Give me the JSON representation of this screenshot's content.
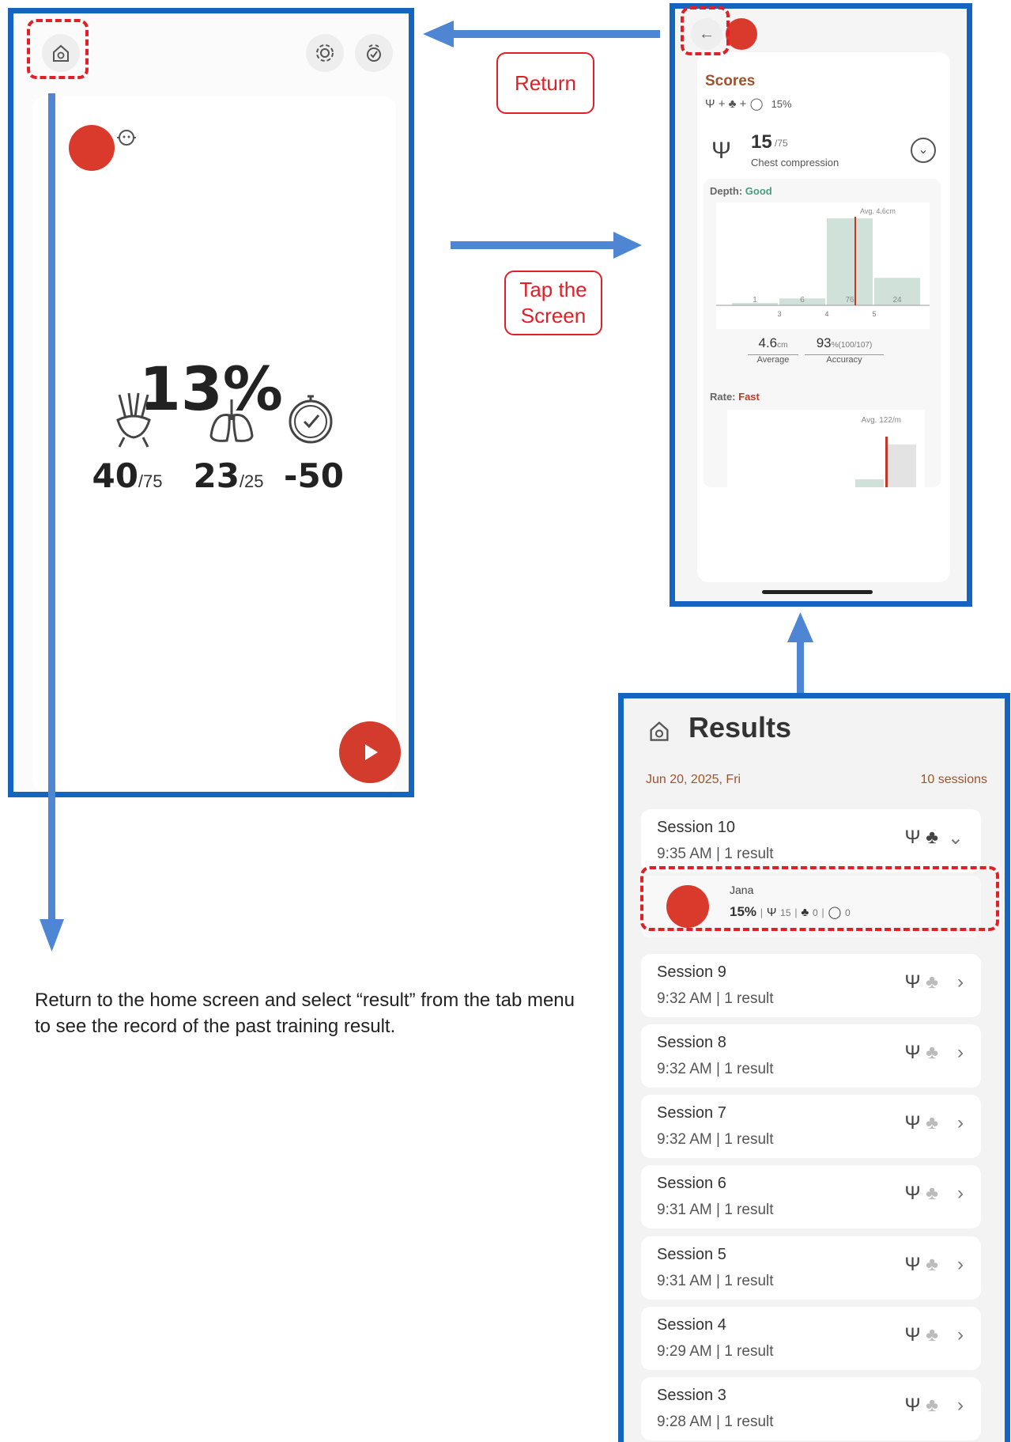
{
  "colors": {
    "frame": "#1565c0",
    "arrow": "#4f86d4",
    "accent_red": "#d93a2b",
    "callout_red": "#e01f26",
    "bar_green": "#cfe1d9"
  },
  "left_screen": {
    "score": "13%",
    "metrics": [
      {
        "icon": "compression-hands-icon",
        "value": "40",
        "max": "/75"
      },
      {
        "icon": "lungs-icon",
        "value": "23",
        "max": "/25"
      },
      {
        "icon": "stopwatch-icon",
        "value": "-50",
        "max": ""
      }
    ],
    "top_icons": [
      "home-icon",
      "settings-icon",
      "stethoscope-icon"
    ],
    "play_icon": "play-icon"
  },
  "callouts": {
    "return": "Return",
    "tap_line1": "Tap the",
    "tap_line2": "Screen"
  },
  "instruction": "Return to the home screen and select “result” from the tab menu to see the record of the past training result.",
  "score_screen": {
    "back_icon": "←",
    "title": "Scores",
    "formula_pct": "15%",
    "compression_score": "15",
    "compression_max": "/75",
    "compression_label": "Chest compression",
    "depth_label": "Depth:",
    "depth_value": "Good",
    "rate_label": "Rate:",
    "rate_value": "Fast",
    "average_value": "4.6",
    "average_unit": "cm",
    "average_label": "Average",
    "accuracy_value": "93",
    "accuracy_detail": "%(100/107)",
    "accuracy_label": "Accuracy",
    "depth_avg_label": "Avg. 4.6cm",
    "rate_avg_label": "Avg. 122/m",
    "depth_chart": {
      "type": "bar",
      "bins": [
        "<3",
        "3-4",
        "4-5",
        ">5"
      ],
      "values": [
        1,
        6,
        76,
        24
      ],
      "bar_labels": [
        "1",
        "6",
        "76",
        "24"
      ],
      "x_ticks": [
        "3",
        "4",
        "5"
      ],
      "avg": 4.6
    }
  },
  "results_screen": {
    "title": "Results",
    "date": "Jun 20, 2025, Fri",
    "session_count": "10 sessions",
    "expanded_result": {
      "name": "Jana",
      "pct": "15%",
      "compression": "15",
      "ventilation": "0",
      "time": "0"
    },
    "sessions": [
      {
        "title": "Session 10",
        "sub": "9:35 AM | 1 result",
        "chevron": "⌄"
      },
      {
        "title": "Session 9",
        "sub": "9:32 AM | 1 result",
        "chevron": "›"
      },
      {
        "title": "Session 8",
        "sub": "9:32 AM | 1 result",
        "chevron": "›"
      },
      {
        "title": "Session 7",
        "sub": "9:32 AM | 1 result",
        "chevron": "›"
      },
      {
        "title": "Session 6",
        "sub": "9:31 AM | 1 result",
        "chevron": "›"
      },
      {
        "title": "Session 5",
        "sub": "9:31 AM | 1 result",
        "chevron": "›"
      },
      {
        "title": "Session 4",
        "sub": "9:29 AM | 1 result",
        "chevron": "›"
      },
      {
        "title": "Session 3",
        "sub": "9:28 AM | 1 result",
        "chevron": "›"
      }
    ]
  }
}
